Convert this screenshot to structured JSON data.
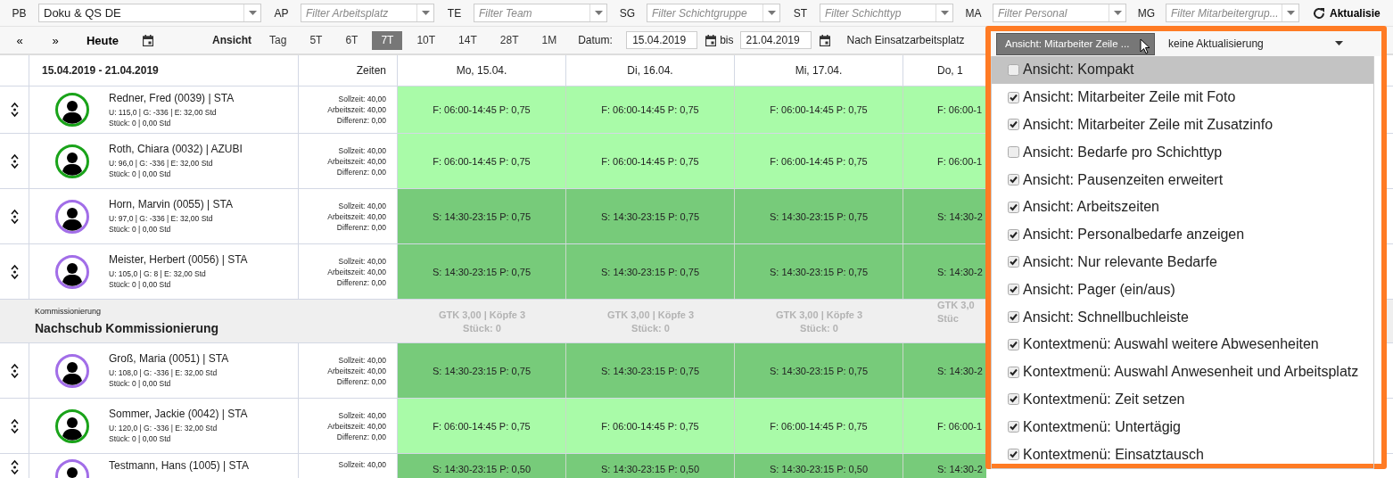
{
  "filters": [
    {
      "label": "PB",
      "value": "Doku & QS DE"
    },
    {
      "label": "AP",
      "placeholder": "Filter Arbeitsplatz"
    },
    {
      "label": "TE",
      "placeholder": "Filter Team"
    },
    {
      "label": "SG",
      "placeholder": "Filter Schichtgruppe"
    },
    {
      "label": "ST",
      "placeholder": "Filter Schichttyp"
    },
    {
      "label": "MA",
      "placeholder": "Filter Personal"
    },
    {
      "label": "MG",
      "placeholder": "Filter Mitarbeitergrup..."
    }
  ],
  "refresh": {
    "label": "Aktualisie"
  },
  "toolbar": {
    "prev": "«",
    "next": "»",
    "today": "Heute",
    "view_label": "Ansicht",
    "ranges": [
      {
        "label": "Tag",
        "selected": false
      },
      {
        "label": "5T",
        "selected": false
      },
      {
        "label": "6T",
        "selected": false
      },
      {
        "label": "7T",
        "selected": true
      },
      {
        "label": "10T",
        "selected": false
      },
      {
        "label": "14T",
        "selected": false
      },
      {
        "label": "28T",
        "selected": false
      },
      {
        "label": "1M",
        "selected": false
      }
    ],
    "date_label": "Datum:",
    "date_from": "15.04.2019",
    "to_label": "bis",
    "date_to": "21.04.2019",
    "grouping": "Nach Einsatzarbeitsplatz"
  },
  "view_menu": {
    "button": "Ansicht: Mitarbeiter Zeile ...",
    "refresh_select": "keine Aktualisierung",
    "items": [
      {
        "label": "Ansicht: Kompakt",
        "checked": false,
        "selected": true
      },
      {
        "label": "Ansicht: Mitarbeiter Zeile mit Foto",
        "checked": true,
        "selected": false
      },
      {
        "label": "Ansicht: Mitarbeiter Zeile mit Zusatzinfo",
        "checked": true,
        "selected": false
      },
      {
        "label": "Ansicht: Bedarfe pro Schichttyp",
        "checked": false,
        "selected": false
      },
      {
        "label": "Ansicht: Pausenzeiten erweitert",
        "checked": true,
        "selected": false
      },
      {
        "label": "Ansicht: Arbeitszeiten",
        "checked": true,
        "selected": false
      },
      {
        "label": "Ansicht: Personalbedarfe anzeigen",
        "checked": true,
        "selected": false
      },
      {
        "label": "Ansicht: Nur relevante Bedarfe",
        "checked": true,
        "selected": false
      },
      {
        "label": "Ansicht: Pager (ein/aus)",
        "checked": true,
        "selected": false
      },
      {
        "label": "Ansicht: Schnellbuchleiste",
        "checked": true,
        "selected": false
      },
      {
        "label": "Kontextmenü: Auswahl weitere Abwesenheiten",
        "checked": true,
        "selected": false
      },
      {
        "label": "Kontextmenü: Auswahl Anwesenheit und Arbeitsplatz",
        "checked": true,
        "selected": false
      },
      {
        "label": "Kontextmenü: Zeit setzen",
        "checked": true,
        "selected": false
      },
      {
        "label": "Kontextmenü: Untertägig",
        "checked": true,
        "selected": false
      },
      {
        "label": "Kontextmenü: Einsatztausch",
        "checked": true,
        "selected": false
      }
    ]
  },
  "table": {
    "period": "15.04.2019 - 21.04.2019",
    "times_header": "Zeiten",
    "days": [
      "Mo, 15.04.",
      "Di, 16.04.",
      "Mi, 17.04.",
      "Do, 1"
    ],
    "rows": [
      {
        "kind": "employee",
        "name": "Redner, Fred (0039) | STA",
        "color": "#1aa31a",
        "info": [
          "U: 115,0 | G: -336 | E: 32,00 Std",
          "Stück: 0 | 0,00 Std"
        ],
        "times": [
          "Sollzeit: 40,00",
          "Arbeitszeit: 40,00",
          "Differenz: 0,00"
        ],
        "shifts": [
          {
            "kind": "early",
            "text": "F: 06:00-14:45 P: 0,75"
          },
          {
            "kind": "early",
            "text": "F: 06:00-14:45 P: 0,75"
          },
          {
            "kind": "early",
            "text": "F: 06:00-14:45 P: 0,75"
          },
          {
            "kind": "early",
            "text": "F: 06:00-1"
          }
        ]
      },
      {
        "kind": "employee",
        "name": "Roth, Chiara (0032) | AZUBI",
        "color": "#1aa31a",
        "info": [
          "U: 96,0 | G: -336 | E: 32,00 Std",
          "Stück: 0 | 0,00 Std"
        ],
        "times": [
          "Sollzeit: 40,00",
          "Arbeitszeit: 40,00",
          "Differenz: 0,00"
        ],
        "shifts": [
          {
            "kind": "early",
            "text": "F: 06:00-14:45 P: 0,75"
          },
          {
            "kind": "early",
            "text": "F: 06:00-14:45 P: 0,75"
          },
          {
            "kind": "early",
            "text": "F: 06:00-14:45 P: 0,75"
          },
          {
            "kind": "early",
            "text": "F: 06:00-1"
          }
        ]
      },
      {
        "kind": "employee",
        "name": "Horn, Marvin (0055) | STA",
        "color": "#a26ee8",
        "info": [
          "U: 97,0 | G: -336 | E: 32,00 Std",
          "Stück: 0 | 0,00 Std"
        ],
        "times": [
          "Sollzeit: 40,00",
          "Arbeitszeit: 40,00",
          "Differenz: 0,00"
        ],
        "shifts": [
          {
            "kind": "late",
            "text": "S: 14:30-23:15 P: 0,75"
          },
          {
            "kind": "late",
            "text": "S: 14:30-23:15 P: 0,75"
          },
          {
            "kind": "late",
            "text": "S: 14:30-23:15 P: 0,75"
          },
          {
            "kind": "late",
            "text": "S: 14:30-2"
          }
        ]
      },
      {
        "kind": "employee",
        "name": "Meister, Herbert (0056) | STA",
        "color": "#a26ee8",
        "info": [
          "U: 105,0 | G: 8 | E: 32,00 Std",
          "Stück: 0 | 0,00 Std"
        ],
        "times": [
          "Sollzeit: 40,00",
          "Arbeitszeit: 40,00",
          "Differenz: 0,00"
        ],
        "shifts": [
          {
            "kind": "late",
            "text": "S: 14:30-23:15 P: 0,75"
          },
          {
            "kind": "late",
            "text": "S: 14:30-23:15 P: 0,75"
          },
          {
            "kind": "late",
            "text": "S: 14:30-23:15 P: 0,75"
          },
          {
            "kind": "late",
            "text": "S: 14:30-2"
          }
        ]
      },
      {
        "kind": "group",
        "category": "Kommissionierung",
        "title": "Nachschub Kommissionierung",
        "days": [
          {
            "summary": "GTK 3,00 | Köpfe 3",
            "count": "Stück: 0"
          },
          {
            "summary": "GTK 3,00 | Köpfe 3",
            "count": "Stück: 0"
          },
          {
            "summary": "GTK 3,00 | Köpfe 3",
            "count": "Stück: 0"
          },
          {
            "summary": "GTK 3,0",
            "count": "Stüc"
          }
        ]
      },
      {
        "kind": "employee",
        "name": "Groß, Maria (0051) | STA",
        "color": "#a26ee8",
        "info": [
          "U: 108,0 | G: -336 | E: 32,00 Std",
          "Stück: 0 | 0,00 Std"
        ],
        "times": [
          "Sollzeit: 40,00",
          "Arbeitszeit: 40,00",
          "Differenz: 0,00"
        ],
        "shifts": [
          {
            "kind": "late",
            "text": "S: 14:30-23:15 P: 0,75"
          },
          {
            "kind": "late",
            "text": "S: 14:30-23:15 P: 0,75"
          },
          {
            "kind": "late",
            "text": "S: 14:30-23:15 P: 0,75"
          },
          {
            "kind": "late",
            "text": "S: 14:30-2"
          }
        ]
      },
      {
        "kind": "employee",
        "name": "Sommer, Jackie (0042) | STA",
        "color": "#1aa31a",
        "info": [
          "U: 120,0 | G: -336 | E: 32,00 Std",
          "Stück: 0 | 0,00 Std"
        ],
        "times": [
          "Sollzeit: 40,00",
          "Arbeitszeit: 40,00",
          "Differenz: 0,00"
        ],
        "shifts": [
          {
            "kind": "early",
            "text": "F: 06:00-14:45 P: 0,75"
          },
          {
            "kind": "early",
            "text": "F: 06:00-14:45 P: 0,75"
          },
          {
            "kind": "early",
            "text": "F: 06:00-14:45 P: 0,75"
          },
          {
            "kind": "early",
            "text": "F: 06:00-1"
          }
        ]
      },
      {
        "kind": "employee",
        "name": "Testmann, Hans (1005) | STA",
        "color": "#a26ee8",
        "info": [],
        "times": [
          "Sollzeit: 40,00"
        ],
        "shifts": [
          {
            "kind": "late",
            "text": "S: 14:30-23:15 P: 0,50"
          },
          {
            "kind": "late",
            "text": "S: 14:30-23:15 P: 0,50"
          },
          {
            "kind": "late",
            "text": "S: 14:30-23:15 P: 0,50"
          },
          {
            "kind": "late",
            "text": "S: 14:30-2"
          }
        ]
      }
    ]
  }
}
